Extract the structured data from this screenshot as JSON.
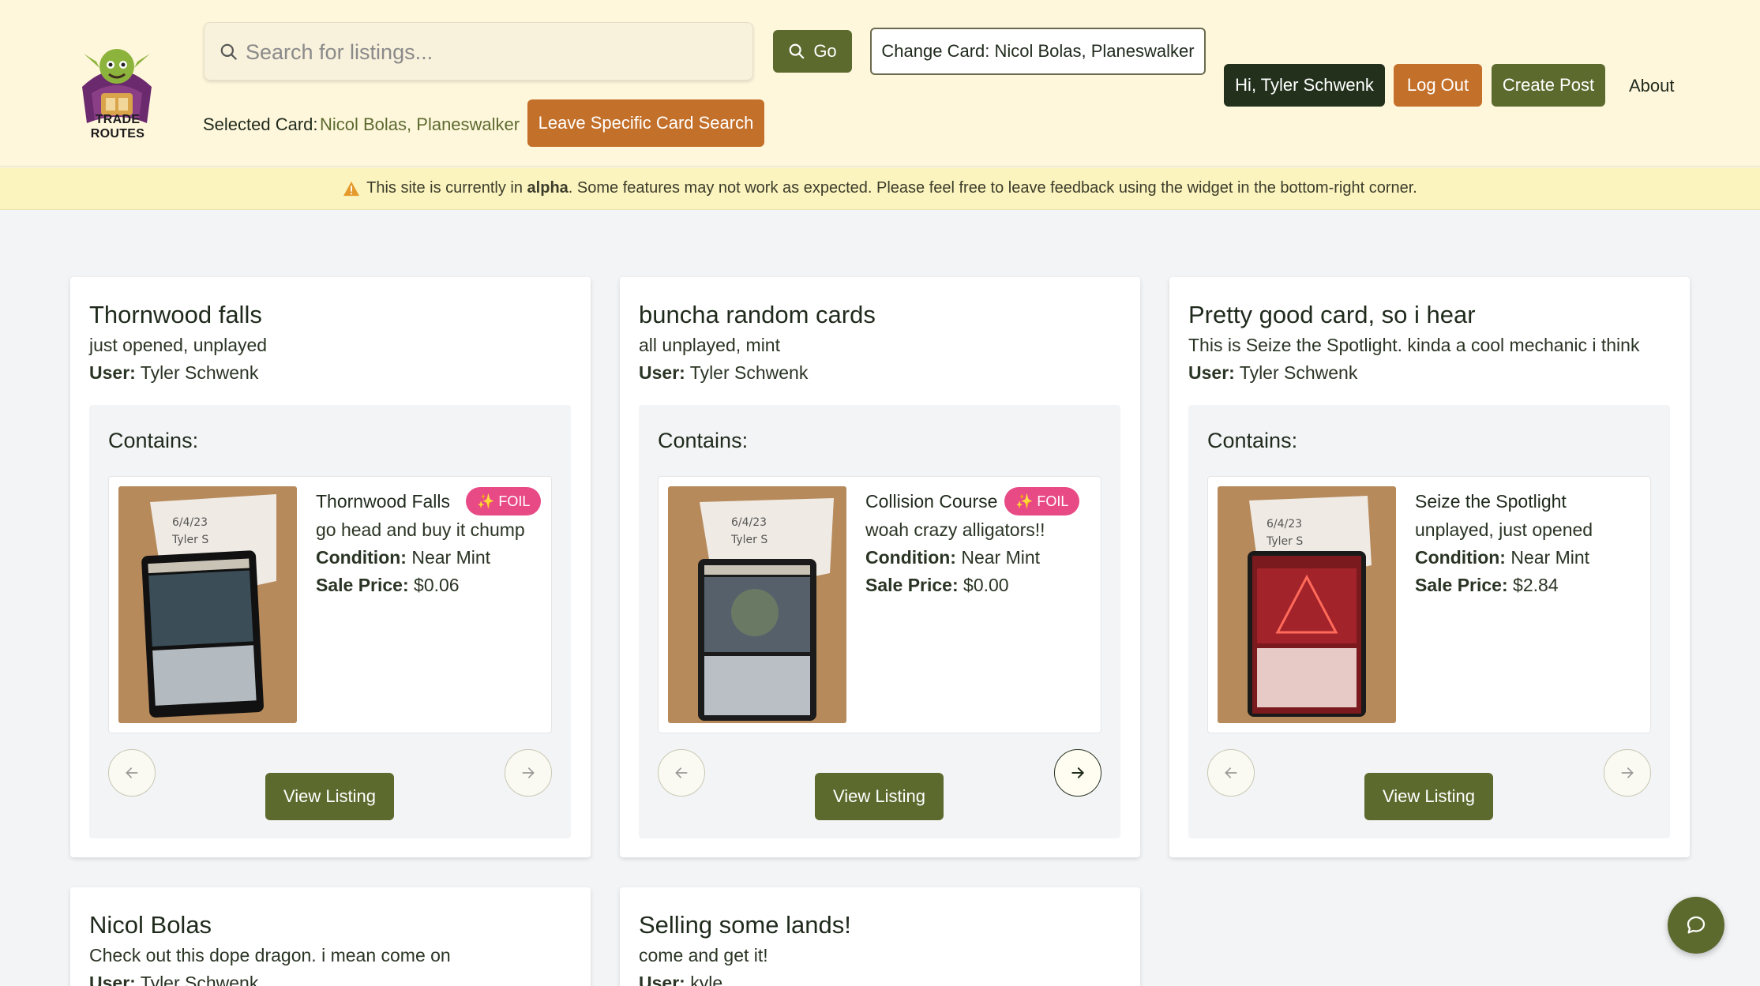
{
  "header": {
    "logo_text": "TRADE ROUTES",
    "search_placeholder": "Search for listings...",
    "go_label": "Go",
    "change_card_label": "Change Card: Nicol Bolas, Planeswalker",
    "greeting_label": "Hi, Tyler Schwenk",
    "logout_label": "Log Out",
    "create_post_label": "Create Post",
    "about_label": "About",
    "selected_card_label": "Selected Card:",
    "selected_card_value": "Nicol Bolas, Planeswalker",
    "leave_search_label": "Leave Specific Card Search"
  },
  "banner": {
    "prefix": "This site is currently in",
    "emphasis": "alpha",
    "suffix": ". Some features may not work as expected. Please feel free to leave feedback using the widget in the bottom-right corner."
  },
  "common": {
    "contains_label": "Contains:",
    "user_label": "User:",
    "condition_label": "Condition:",
    "price_label": "Sale Price:",
    "foil_label": "FOIL",
    "view_listing_label": "View Listing"
  },
  "listings": [
    {
      "title": "Thornwood falls",
      "description": "just opened, unplayed",
      "user": "Tyler Schwenk",
      "item": {
        "name": "Thornwood Falls",
        "foil": true,
        "note": "go head and buy it chump",
        "condition": "Near Mint",
        "price": "$0.06",
        "card_color": "#2c3a3e",
        "art_color": "#3b4d57"
      }
    },
    {
      "title": "buncha random cards",
      "description": "all unplayed, mint",
      "user": "Tyler Schwenk",
      "item": {
        "name": "Collision Course",
        "foil": true,
        "note": "woah crazy alligators!!",
        "condition": "Near Mint",
        "price": "$0.00",
        "card_color": "#2b2b2b",
        "art_color": "#55606a"
      }
    },
    {
      "title": "Pretty good card, so i hear",
      "description": "This is Seize the Spotlight. kinda a cool mechanic i think",
      "user": "Tyler Schwenk",
      "item": {
        "name": "Seize the Spotlight",
        "foil": false,
        "note": "unplayed, just opened",
        "condition": "Near Mint",
        "price": "$2.84",
        "card_color": "#7a1a1e",
        "art_color": "#a3232a"
      }
    },
    {
      "title": "Nicol Bolas",
      "description": "Check out this dope dragon. i mean come on",
      "user": "Tyler Schwenk"
    },
    {
      "title": "Selling some lands!",
      "description": "come and get it!",
      "user": "kyle"
    }
  ],
  "colors": {
    "header_bg": "#fff7dc",
    "primary_green": "#5c6a2e",
    "dark_green": "#23311c",
    "orange": "#c3702a",
    "foil_pink": "#e84a86",
    "banner_bg": "#fbf4bf"
  }
}
